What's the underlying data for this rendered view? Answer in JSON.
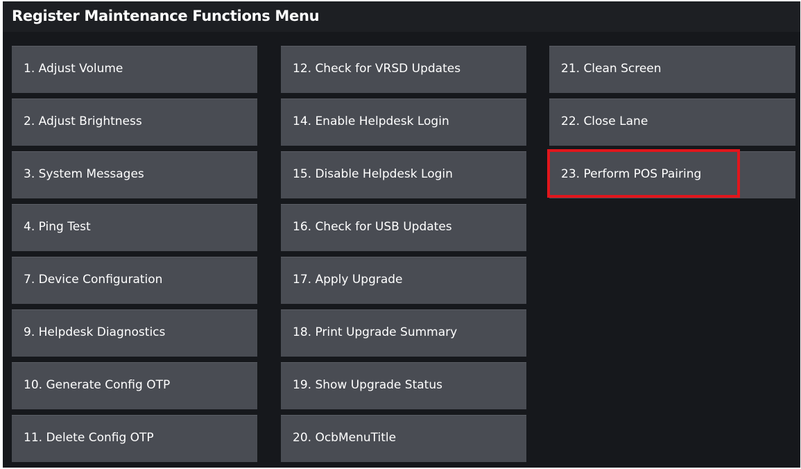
{
  "header": {
    "title": "Register Maintenance Functions Menu"
  },
  "menu": {
    "column_1": [
      {
        "label": "1. Adjust Volume"
      },
      {
        "label": "2. Adjust Brightness"
      },
      {
        "label": "3. System Messages"
      },
      {
        "label": "4. Ping Test"
      },
      {
        "label": "7. Device Configuration"
      },
      {
        "label": "9. Helpdesk Diagnostics"
      },
      {
        "label": "10. Generate Config OTP"
      },
      {
        "label": "11. Delete Config OTP"
      }
    ],
    "column_2": [
      {
        "label": "12. Check for VRSD Updates"
      },
      {
        "label": "14. Enable Helpdesk Login"
      },
      {
        "label": "15. Disable Helpdesk Login"
      },
      {
        "label": "16. Check for USB Updates"
      },
      {
        "label": "17. Apply Upgrade"
      },
      {
        "label": "18. Print Upgrade Summary"
      },
      {
        "label": "19. Show Upgrade Status"
      },
      {
        "label": "20. OcbMenuTitle"
      }
    ],
    "column_3": [
      {
        "label": "21. Clean Screen"
      },
      {
        "label": "22. Close Lane"
      },
      {
        "label": "23. Perform POS Pairing",
        "highlighted": true
      }
    ]
  },
  "colors": {
    "background": "#16181c",
    "button": "#494c53",
    "text": "#ffffff",
    "highlight_border": "#e1161c"
  }
}
